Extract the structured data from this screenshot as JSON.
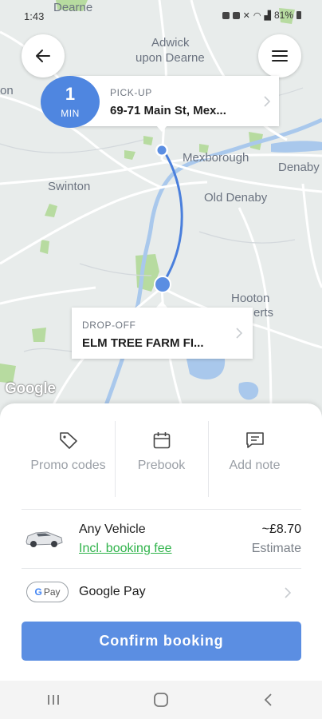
{
  "status_bar": {
    "time": "1:43",
    "battery": "81%"
  },
  "map": {
    "places": [
      {
        "name": "Dearne"
      },
      {
        "name": "Adwick"
      },
      {
        "name": "upon Dearne"
      },
      {
        "name": "on"
      },
      {
        "name": "Mexborough"
      },
      {
        "name": "Denaby"
      },
      {
        "name": "Swinton"
      },
      {
        "name": "Old Denaby"
      },
      {
        "name": "Hooton"
      },
      {
        "name": "erts"
      }
    ],
    "attribution": "Google",
    "route_color": "#4a7fdc"
  },
  "pickup": {
    "eta_value": "1",
    "eta_unit": "MIN",
    "caption": "PICK-UP",
    "address": "69-71 Main St, Mex..."
  },
  "dropoff": {
    "caption": "DROP-OFF",
    "address": "ELM TREE FARM FI..."
  },
  "actions": [
    {
      "label": "Promo codes",
      "icon": "tag-icon"
    },
    {
      "label": "Prebook",
      "icon": "calendar-icon"
    },
    {
      "label": "Add note",
      "icon": "note-icon"
    }
  ],
  "vehicle": {
    "name": "Any Vehicle",
    "fee_note": "Incl. booking fee",
    "price": "~£8.70",
    "price_note": "Estimate"
  },
  "payment": {
    "badge_g": "G",
    "badge_text": "Pay",
    "label": "Google Pay"
  },
  "confirm_label": "Confirm booking",
  "colors": {
    "accent": "#4f86e0",
    "confirm": "#5b8ee2",
    "fee_link": "#2fb34a"
  }
}
